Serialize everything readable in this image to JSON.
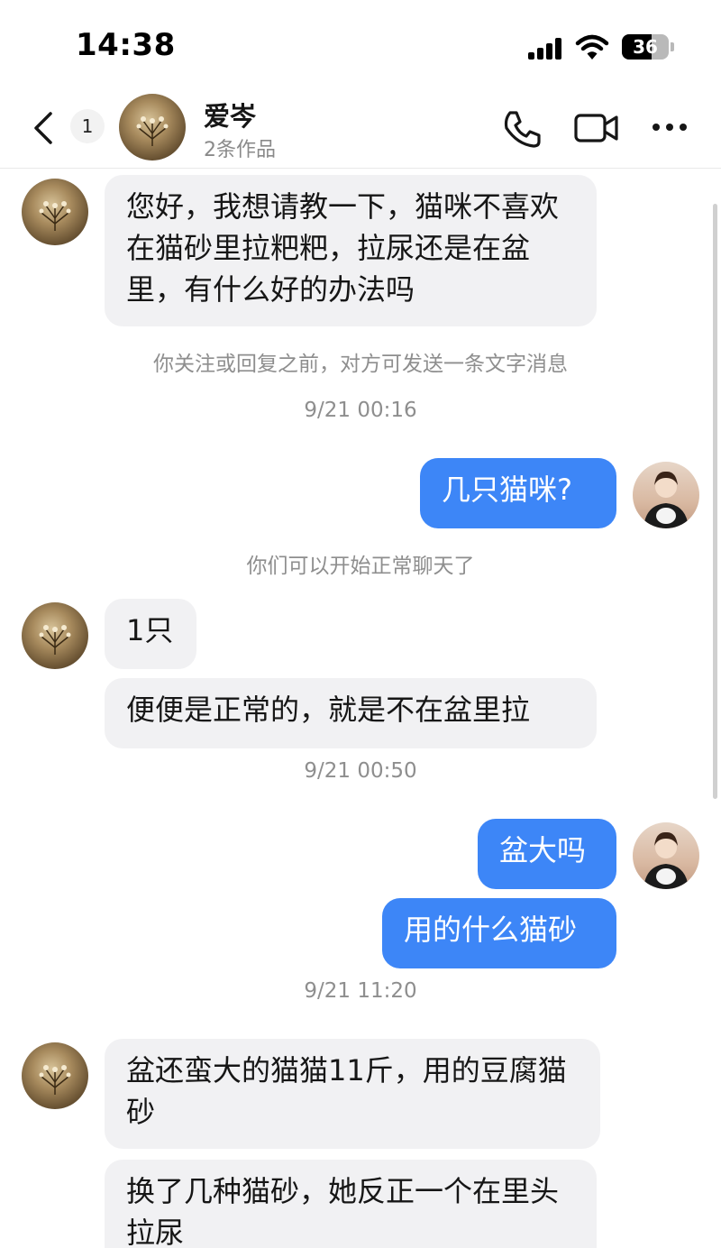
{
  "status_bar": {
    "time": "14:38",
    "battery": "36"
  },
  "header": {
    "back_badge": "1",
    "contact_name": "爱岑",
    "contact_sub": "2条作品"
  },
  "messages": {
    "m1": "您好，我想请教一下，猫咪不喜欢在猫砂里拉粑粑，拉尿还是在盆里，有什么好的办法吗",
    "notice1": "你关注或回复之前，对方可发送一条文字消息",
    "time1": "9/21 00:16",
    "m2": "几只猫咪?",
    "notice2": "你们可以开始正常聊天了",
    "m3": "1只",
    "m4": "便便是正常的，就是不在盆里拉",
    "time2": "9/21 00:50",
    "m5": "盆大吗",
    "m6": "用的什么猫砂",
    "time3": "9/21 11:20",
    "m7": "盆还蛮大的猫猫11斤，用的豆腐猫砂",
    "m8": "换了几种猫砂，她反正一个在里头拉尿"
  },
  "icons": {
    "back": "chevron-left-icon",
    "call": "phone-icon",
    "video": "video-camera-icon",
    "more": "more-dots-icon"
  },
  "colors": {
    "outgoing_bubble": "#3d86f7",
    "incoming_bubble": "#f1f1f3",
    "meta_text": "#8e8e8e"
  }
}
